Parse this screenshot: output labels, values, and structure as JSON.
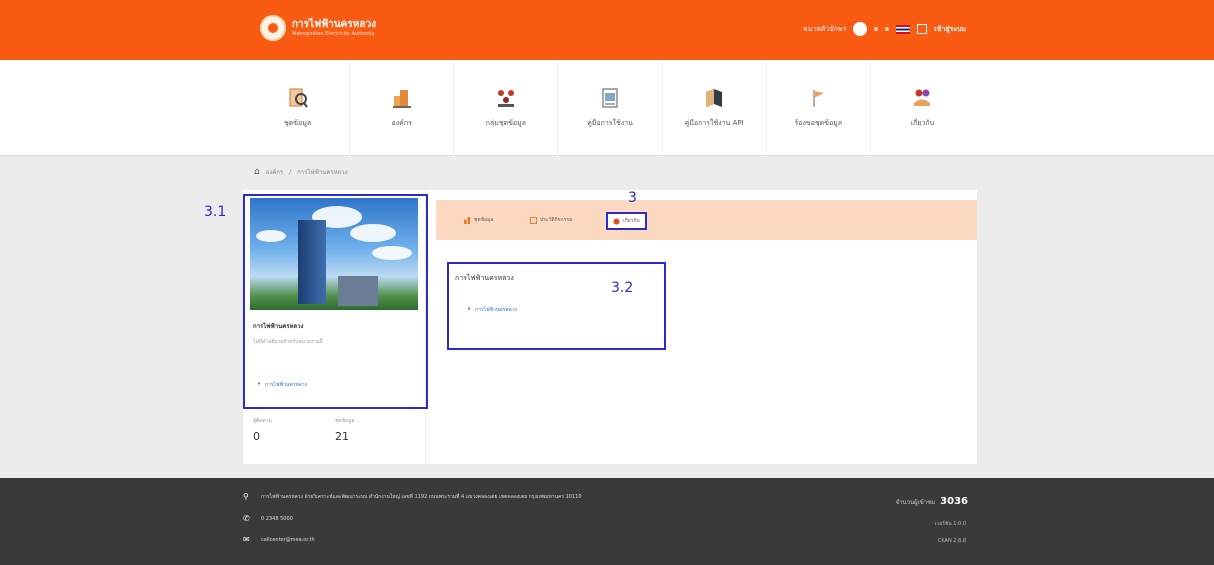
{
  "header": {
    "logo_title": "การไฟฟ้านครหลวง",
    "logo_subtitle": "Metropolitan Electricity Authority",
    "font_size_label": "ขนาดตัวอักษร",
    "login_label": "เข้าสู่ระบบ",
    "colors": {
      "brand": "#f95b13"
    }
  },
  "nav": {
    "items": [
      {
        "label": "ชุดข้อมูล",
        "icon": "dataset-icon"
      },
      {
        "label": "องค์กร",
        "icon": "organization-icon"
      },
      {
        "label": "กลุ่มชุดข้อมูล",
        "icon": "group-icon"
      },
      {
        "label": "คู่มือการใช้งาน",
        "icon": "manual-icon"
      },
      {
        "label": "คู่มือการใช้งาน API",
        "icon": "api-manual-icon"
      },
      {
        "label": "ร้องขอชุดข้อมูล",
        "icon": "request-icon"
      },
      {
        "label": "เกี่ยวกับ",
        "icon": "about-icon"
      }
    ]
  },
  "breadcrumb": {
    "items": [
      "องค์กร",
      "การไฟฟ้านครหลวง"
    ]
  },
  "org_card": {
    "title": "การไฟฟ้านครหลวง",
    "subtitle": "ไม่มีคำอธิบายสำหรับหน่วยงานนี้",
    "link": "การไฟฟ้านครหลวง",
    "stats": [
      {
        "label": "ผู้ติดตาม",
        "value": "0"
      },
      {
        "label": "ชุดข้อมูล",
        "value": "21"
      }
    ]
  },
  "tabs": {
    "items": [
      "ชุดข้อมูล",
      "ประวัติกิจกรรม",
      "เกี่ยวกับ"
    ],
    "active": "เกี่ยวกับ"
  },
  "content": {
    "title": "การไฟฟ้านครหลวง",
    "link": "การไฟฟ้านครหลวง"
  },
  "annotations": {
    "a1": "3.1",
    "a2": "3",
    "a3": "3.2"
  },
  "footer": {
    "address": "การไฟฟ้านครหลวง ฝ่ายวิเคราะห์และพัฒนาระบบ สำนักงานใหญ่ เลขที่ 1192 ถนนพระรามที่ 4 แขวงคลองเตย เขตคลองเตย กรุงเทพมหานคร 10110",
    "phone": "0 2348 5000",
    "email": "callcenter@mea.or.th",
    "visits_label": "จำนวนผู้เข้าชม",
    "visits_value": "3036",
    "right_line1": "เวอร์ชัน 1.0.0",
    "right_line2": "CKAN 2.8.8"
  }
}
